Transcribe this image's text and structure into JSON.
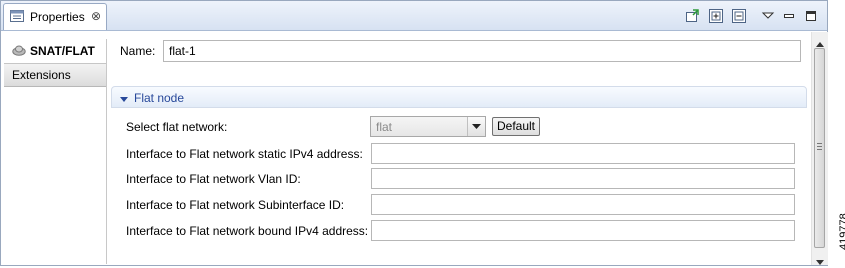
{
  "tab": {
    "label": "Properties",
    "close": "⊗"
  },
  "sidebar": {
    "items": [
      {
        "label": "SNAT/FLAT"
      },
      {
        "label": "Extensions"
      }
    ]
  },
  "name": {
    "label": "Name:",
    "value": "flat-1"
  },
  "section": {
    "title": "Flat node"
  },
  "fields": {
    "select_flat_network": {
      "label": "Select flat network:",
      "value": "flat",
      "button": "Default"
    },
    "static_ipv4": {
      "label": "Interface to Flat network static IPv4 address:",
      "value": ""
    },
    "vlan_id": {
      "label": "Interface to Flat network Vlan ID:",
      "value": ""
    },
    "subinterface_id": {
      "label": "Interface to Flat network Subinterface ID:",
      "value": ""
    },
    "bound_ipv4": {
      "label": "Interface to Flat network bound IPv4 address:",
      "value": ""
    }
  },
  "figure_id": "419778",
  "icons": [
    "properties-icon",
    "pin-icon",
    "expand-all-icon",
    "collapse-all-icon",
    "view-menu-icon",
    "minimize-icon",
    "maximize-icon",
    "cloud-icon",
    "dropdown-arrow-icon"
  ],
  "colors": {
    "section_title": "#27489a",
    "tabbar": "#d7e2f2"
  }
}
